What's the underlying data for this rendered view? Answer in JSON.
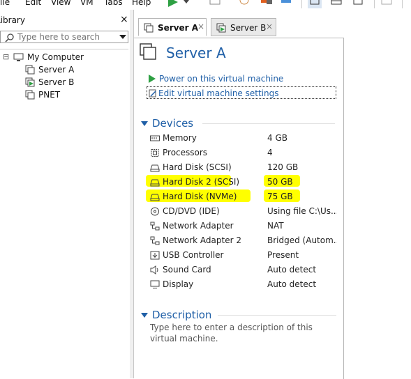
{
  "menu": {
    "items": [
      "File",
      "Edit",
      "View",
      "VM",
      "Tabs",
      "Help"
    ]
  },
  "toolbar": {
    "icons": [
      "play-icon",
      "dropdown-icon",
      "snapshot-icon",
      "revert-icon",
      "manage-icon",
      "library-view-icon",
      "console-view-icon",
      "fullscreen-icon"
    ]
  },
  "library": {
    "title": "Library",
    "close": "×",
    "search_placeholder": "Type here to search",
    "tree": [
      {
        "label": "My Computer",
        "icon": "computer-icon",
        "expander": "⊟"
      },
      {
        "label": "Server A",
        "icon": "vm-icon"
      },
      {
        "label": "Server B",
        "icon": "vm-running-icon"
      },
      {
        "label": "PNET",
        "icon": "vm-icon"
      }
    ]
  },
  "tabs": [
    {
      "label": "Server A",
      "close": "×",
      "active": true
    },
    {
      "label": "Server B",
      "close": "×",
      "active": false
    }
  ],
  "vm": {
    "title": "Server A",
    "actions": [
      {
        "label": "Power on this virtual machine",
        "icon": "play-icon"
      },
      {
        "label": "Edit virtual machine settings",
        "icon": "settings-icon"
      }
    ],
    "devices_header": "Devices",
    "devices": [
      {
        "name": "Memory",
        "value": "4 GB",
        "icon": "memory-icon"
      },
      {
        "name": "Processors",
        "value": "4",
        "icon": "processor-icon"
      },
      {
        "name": "Hard Disk (SCSI)",
        "value": "120 GB",
        "icon": "hard-disk-icon"
      },
      {
        "name": "Hard Disk 2 (SCSI)",
        "value": "50 GB",
        "icon": "hard-disk-icon",
        "highlighted": true
      },
      {
        "name": "Hard Disk (NVMe)",
        "value": "75 GB",
        "icon": "hard-disk-icon",
        "highlighted": true
      },
      {
        "name": "CD/DVD (IDE)",
        "value": "Using file C:\\Us...",
        "icon": "cd-dvd-icon"
      },
      {
        "name": "Network Adapter",
        "value": "NAT",
        "icon": "network-adapter-icon"
      },
      {
        "name": "Network Adapter 2",
        "value": "Bridged (Autom...",
        "icon": "network-adapter-icon"
      },
      {
        "name": "USB Controller",
        "value": "Present",
        "icon": "usb-icon"
      },
      {
        "name": "Sound Card",
        "value": "Auto detect",
        "icon": "sound-icon"
      },
      {
        "name": "Display",
        "value": "Auto detect",
        "icon": "display-icon"
      }
    ],
    "description_header": "Description",
    "description_placeholder": "Type here to enter a description of this virtual machine."
  },
  "colors": {
    "accent": "#1f5fa7",
    "highlight": "#ffff00",
    "play": "#2ea043"
  }
}
